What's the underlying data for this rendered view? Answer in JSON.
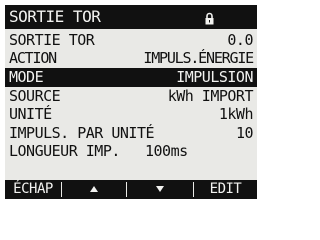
{
  "header": {
    "title": "SORTIE TOR",
    "lock_icon": "lock-icon"
  },
  "rows": [
    {
      "label": "SORTIE TOR",
      "value": "0.0",
      "selected": false
    },
    {
      "label": "ACTION",
      "value": "IMPULS.ÉNERGIE",
      "selected": false
    },
    {
      "label": "MODE",
      "value": "IMPULSION",
      "selected": true
    },
    {
      "label": "SOURCE",
      "value": "kWh IMPORT",
      "selected": false
    },
    {
      "label": "UNITÉ",
      "value": "1kWh",
      "selected": false
    },
    {
      "label": "IMPULS. PAR UNITÉ",
      "value": "10",
      "selected": false
    },
    {
      "label": "LONGUEUR IMP.",
      "value": "100ms",
      "selected": false
    }
  ],
  "softkeys": {
    "escape": "ÉCHAP",
    "up_icon": "up-arrow-icon",
    "down_icon": "down-arrow-icon",
    "edit": "EDIT"
  },
  "colors": {
    "display_background": "#e9e9e6",
    "text_dark": "#111111",
    "inverse_text": "#f2f2f0"
  }
}
